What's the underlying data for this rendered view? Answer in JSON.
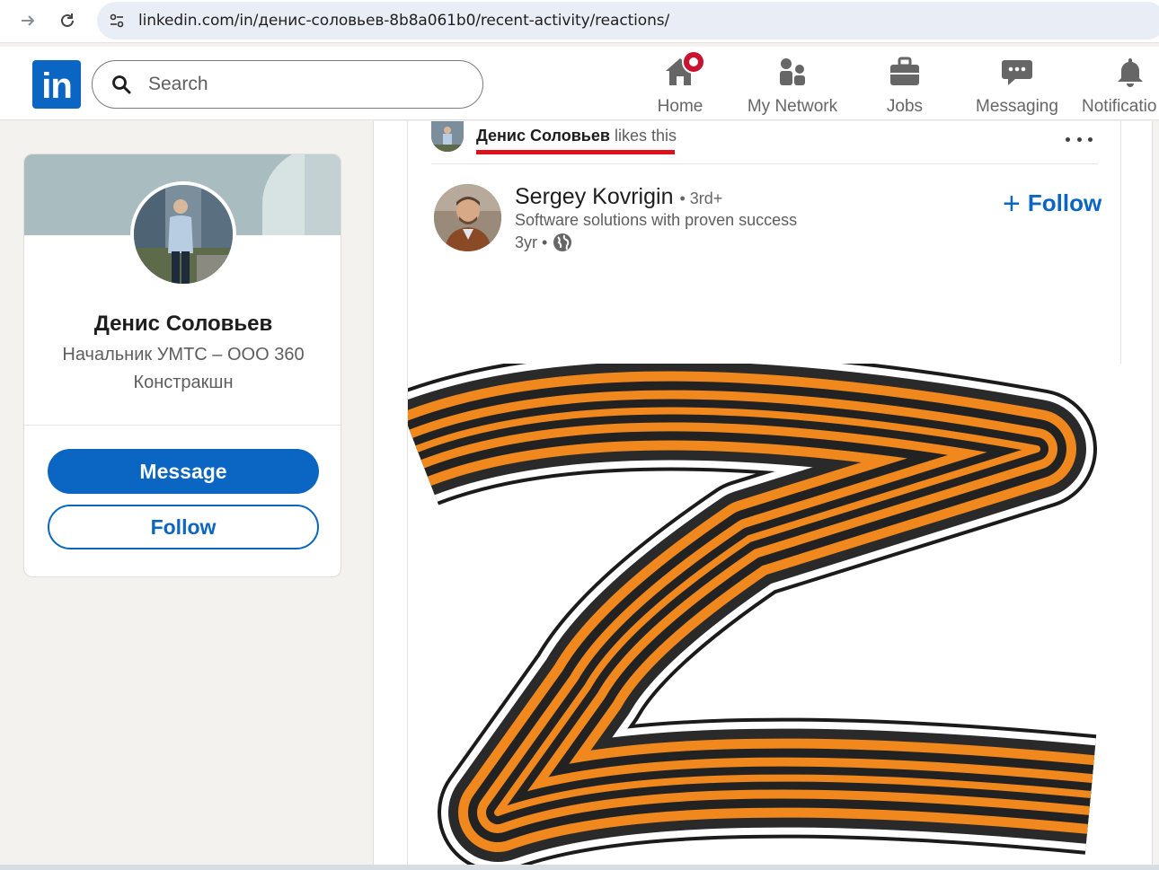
{
  "browser": {
    "url": "linkedin.com/in/денис-соловьев-8b8a061b0/recent-activity/reactions/"
  },
  "header": {
    "logo_text": "in",
    "search_placeholder": "Search",
    "nav": [
      {
        "label": "Home",
        "icon": "home-icon",
        "has_badge": true
      },
      {
        "label": "My Network",
        "icon": "people-icon"
      },
      {
        "label": "Jobs",
        "icon": "briefcase-icon"
      },
      {
        "label": "Messaging",
        "icon": "chat-icon"
      },
      {
        "label": "Notificatio",
        "icon": "bell-icon"
      }
    ]
  },
  "profile": {
    "name": "Денис Соловьев",
    "headline": "Начальник УМТС – ООО 360 Констракшн",
    "message_label": "Message",
    "follow_label": "Follow"
  },
  "activity": {
    "actor": "Денис Соловьев",
    "action": "likes this"
  },
  "post": {
    "author_name": "Sergey Kovrigin",
    "degree": "• 3rd+",
    "author_headline": "Software solutions with proven success",
    "time": "3yr •",
    "follow_label": "Follow",
    "image": "orange-black-striped-z-symbol"
  },
  "colors": {
    "linkedin_blue": "#0a66c2",
    "highlight_red": "#e0101c",
    "ribbon_orange": "#f0881e",
    "ribbon_black": "#222222"
  }
}
